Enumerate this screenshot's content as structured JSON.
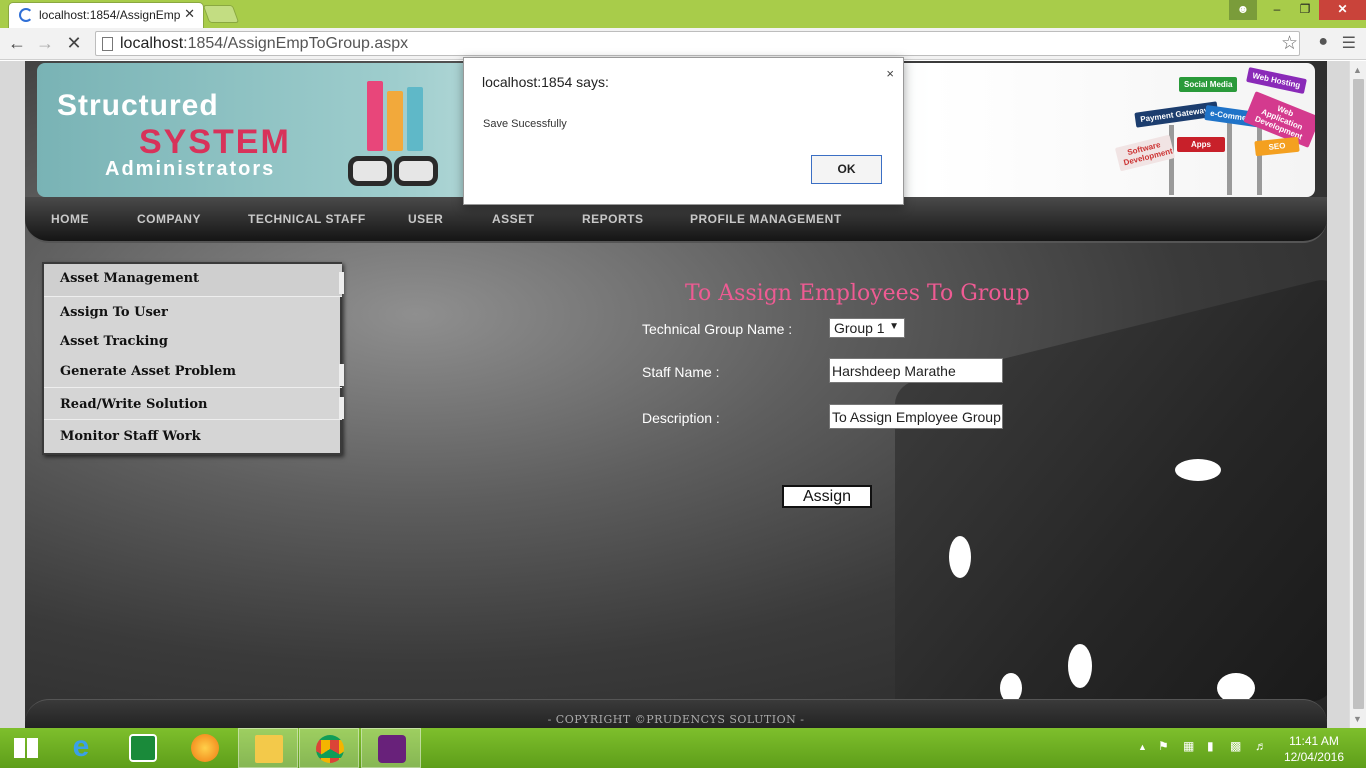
{
  "browser": {
    "tab_title": "localhost:1854/AssignEmp",
    "tab_close": "✕",
    "url_host": "localhost",
    "url_rest": ":1854/AssignEmpToGroup.aspx",
    "back_icon": "arrow-left-icon",
    "forward_icon": "arrow-right-icon",
    "stop_icon": "close-icon",
    "window_buttons": {
      "minimize": "–",
      "maximize": "❐",
      "close": "✕"
    }
  },
  "banner": {
    "logo_line1": "Structured",
    "logo_line2": "SYSTEM",
    "logo_line3": "Administrators",
    "signs": [
      "Social Media",
      "Web Hosting",
      "Payment Gateways",
      "e-Commerce",
      "Web Application Development",
      "Software Development",
      "Apps",
      "SEO"
    ]
  },
  "menu": [
    "HOME",
    "COMPANY",
    "TECHNICAL STAFF",
    "USER",
    "ASSET",
    "REPORTS",
    "PROFILE MANAGEMENT"
  ],
  "sidebar": [
    "Asset Management",
    "Assign To User",
    "Asset Tracking",
    "Generate Asset Problem",
    "Read/Write Solution",
    "Monitor Staff Work"
  ],
  "form": {
    "title": "To Assign Employees To Group",
    "group_label": "Technical Group Name :",
    "group_value": "Group 1",
    "staff_label": "Staff Name :",
    "staff_value": "Harshdeep Marathe",
    "desc_label": "Description :",
    "desc_value": "To Assign Employee Group",
    "assign_button": "Assign"
  },
  "footer": "- COPYRIGHT ©PRUDENCYS SOLUTION -",
  "dialog": {
    "title": "localhost:1854 says:",
    "message": "Save Sucessfully",
    "ok_button": "OK",
    "close": "×"
  },
  "taskbar": {
    "clock_time": "11:41 AM",
    "clock_date": "12/04/2016",
    "apps": [
      "start-icon",
      "internet-explorer-icon",
      "store-icon",
      "orange-app-icon",
      "file-explorer-icon",
      "chrome-icon",
      "visual-studio-icon"
    ]
  },
  "colors": {
    "accent_title": "#ee5b93",
    "taskbar": "#6aae22",
    "titlebar": "#a8cc4a"
  }
}
